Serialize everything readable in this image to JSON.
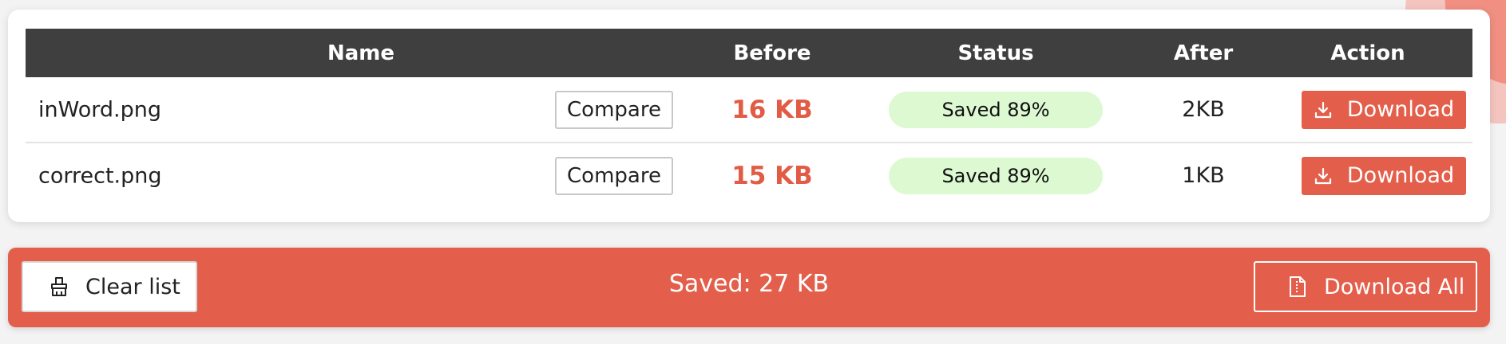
{
  "table": {
    "headers": [
      "Name",
      "Before",
      "Status",
      "After",
      "Action"
    ],
    "compare_label": "Compare",
    "download_label": "Download",
    "rows": [
      {
        "name": "inWord.png",
        "before": "16 KB",
        "status": "Saved 89%",
        "after": "2KB"
      },
      {
        "name": "correct.png",
        "before": "15 KB",
        "status": "Saved 89%",
        "after": "1KB"
      }
    ]
  },
  "footer": {
    "clear_label": "Clear list",
    "saved_total": "Saved: 27 KB",
    "download_all_label": "Download All"
  },
  "icons": {
    "download": "download-icon",
    "clear": "broom-icon",
    "download_all": "zip-file-icon"
  },
  "colors": {
    "accent": "#e35f4b",
    "header_bg": "#3f3f3f",
    "status_bg": "#dcf9d2"
  }
}
